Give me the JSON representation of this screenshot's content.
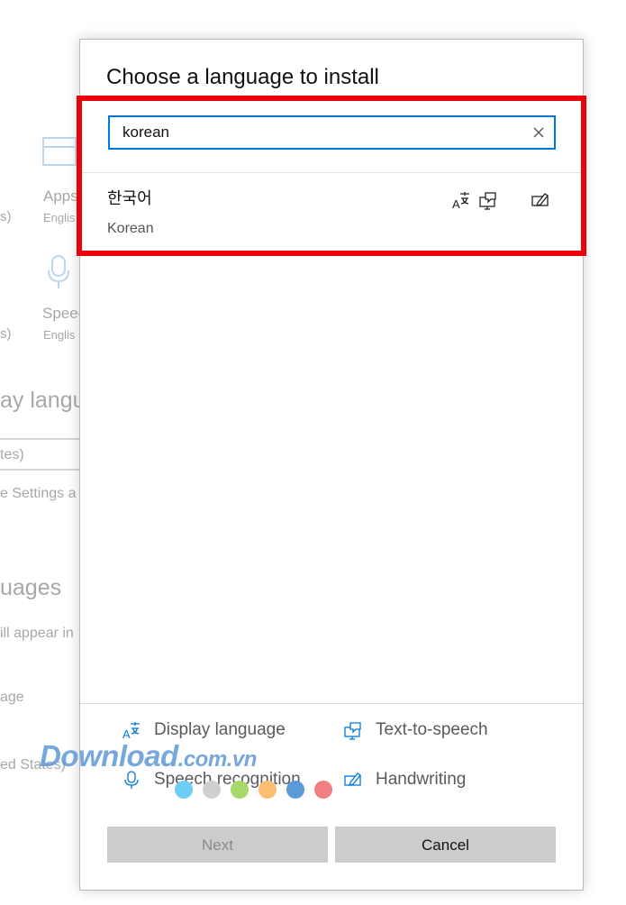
{
  "background": {
    "apps_label": "Apps",
    "apps_sub": "Englis",
    "s1": "s)",
    "speech_label": "Speec",
    "speech_sub": "Englis",
    "s2": "s)",
    "display_language_heading": "ay langu",
    "field_value": "tes)",
    "settings_text": "e Settings a",
    "languages_heading": "uages",
    "appear_text": "ill appear in",
    "age_text": "age",
    "states_text": "ed States)"
  },
  "dialog": {
    "title": "Choose a language to install",
    "search": {
      "value": "korean"
    },
    "results": [
      {
        "native": "한국어",
        "english": "Korean",
        "features": [
          "display-language",
          "text-to-speech",
          "handwriting"
        ]
      }
    ],
    "legend": {
      "display_language": "Display language",
      "text_to_speech": "Text-to-speech",
      "speech_recognition": "Speech recognition",
      "handwriting": "Handwriting"
    },
    "buttons": {
      "next": "Next",
      "cancel": "Cancel"
    }
  },
  "colors": {
    "accent": "#0078d7",
    "highlight": "#e8000b",
    "watermark": "#5f9ad8",
    "dots": [
      "#6ecff6",
      "#cfcfcf",
      "#a6d96a",
      "#fdbf6f",
      "#5b9bd5",
      "#f08080"
    ]
  },
  "watermark": {
    "text": "Download",
    "domain": ".com.vn"
  }
}
